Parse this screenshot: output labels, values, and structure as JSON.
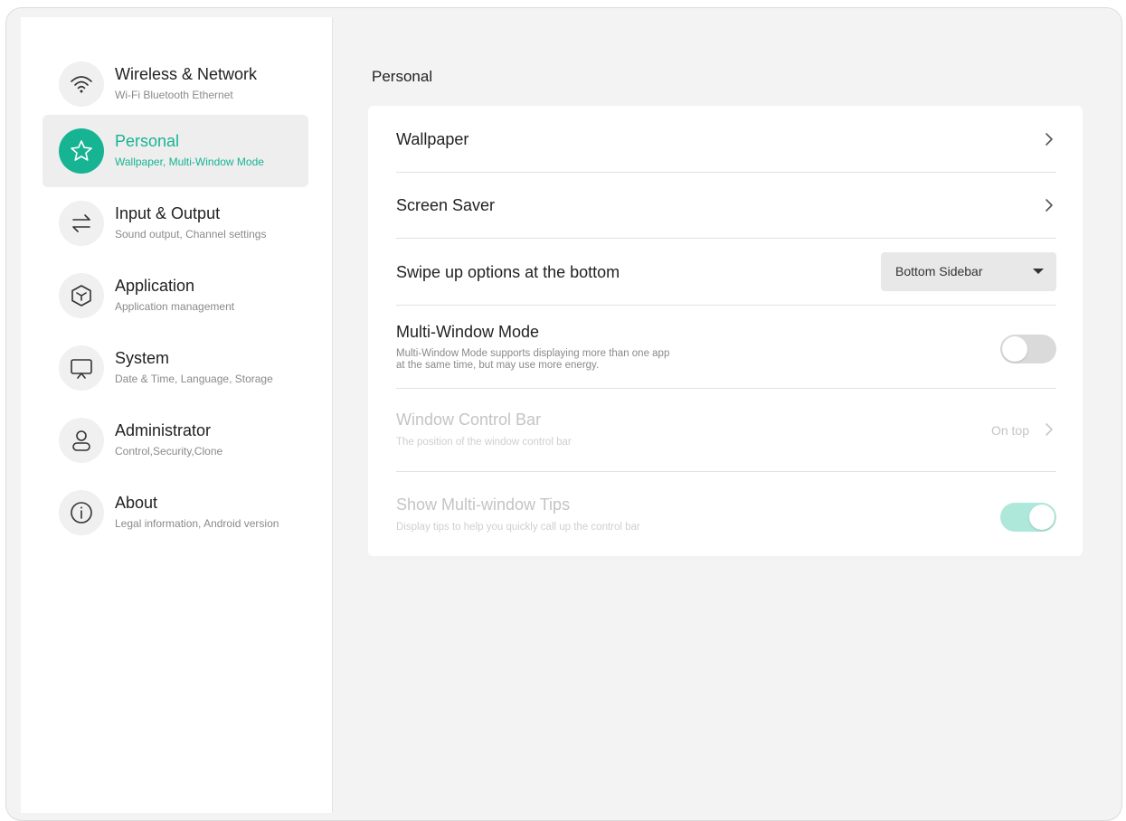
{
  "colors": {
    "accent": "#17b494",
    "accent_light": "#aee8da"
  },
  "sidebar": {
    "items": [
      {
        "title": "Wireless & Network",
        "subtitle": "Wi-Fi Bluetooth Ethernet",
        "icon": "wifi-icon",
        "active": false
      },
      {
        "title": "Personal",
        "subtitle": "Wallpaper, Multi-Window Mode",
        "icon": "star-icon",
        "active": true
      },
      {
        "title": "Input & Output",
        "subtitle": "Sound output, Channel settings",
        "icon": "swap-arrows-icon",
        "active": false
      },
      {
        "title": "Application",
        "subtitle": "Application management",
        "icon": "cube-icon",
        "active": false
      },
      {
        "title": "System",
        "subtitle": "Date & Time, Language, Storage",
        "icon": "monitor-icon",
        "active": false
      },
      {
        "title": "Administrator",
        "subtitle": "Control,Security,Clone",
        "icon": "user-icon",
        "active": false
      },
      {
        "title": "About",
        "subtitle": "Legal information, Android version",
        "icon": "info-icon",
        "active": false
      }
    ]
  },
  "main": {
    "title": "Personal",
    "rows": {
      "wallpaper": {
        "title": "Wallpaper"
      },
      "screen_saver": {
        "title": "Screen Saver"
      },
      "swipe_up": {
        "title": "Swipe up options at the bottom",
        "value": "Bottom Sidebar"
      },
      "multi_window": {
        "title": "Multi-Window Mode",
        "desc_line1": "Multi-Window Mode supports displaying more than one app",
        "desc_line2": "at the same time, but may use more energy.",
        "enabled": false
      },
      "window_control_bar": {
        "title": "Window Control Bar",
        "desc": "The position of the window control bar",
        "value": "On top",
        "disabled": true
      },
      "multi_window_tips": {
        "title": "Show Multi-window Tips",
        "desc": "Display tips to help you quickly call up the control bar",
        "enabled": true,
        "disabled": true
      }
    }
  }
}
